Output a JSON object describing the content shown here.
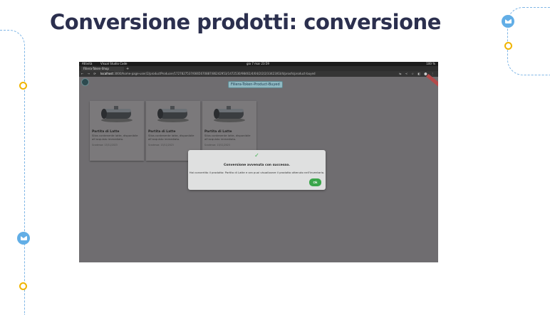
{
  "slide": {
    "title": "Conversione prodotti: conversione"
  },
  "browser": {
    "os_bar": {
      "left": "Attività",
      "app": "Visual Studio Code",
      "clock": "gio 7 mar 23:59",
      "battery": "100 %"
    },
    "tab_label": "Filiera-Token-Shop",
    "tab_plus": "+",
    "url_host": "localhost",
    "url_path": ":3000/home-page-user/2/productProducer/1727827537/6665670887/86242953/1472530/98461/4/04/2/2/2/33423/63/4/proofs/product-buyed",
    "nav_icons": "← → ⟳",
    "url_right_icons": "⇆ ≺ ☆ ◧ ⬤ ⋮"
  },
  "app": {
    "header_title": "Filiera-Token-Product-Buyed",
    "cards": [
      {
        "name": "Partita di Latte",
        "desc": "Silos contenente latte, disponibile all'acquisto immediato.",
        "date": "Scadenza: 13/11/2023"
      },
      {
        "name": "Partita di Latte",
        "desc": "Silos contenente latte, disponibile all'acquisto immediato.",
        "date": "Scadenza: 13/11/2023"
      },
      {
        "name": "Partita di Latte",
        "desc": "Silos contenente latte, disponibile all'acquisto immediato.",
        "date": "Scadenza: 13/11/2023"
      }
    ]
  },
  "dialog": {
    "check": "✓",
    "title": "Conversione avvenuta con successo.",
    "message": "Hai convertito il prodotto: Partita di Latte e ora puoi visualizzare il prodotto ottenuto nell'inventario.",
    "ok_label": "Ok"
  },
  "colors": {
    "title": "#2b2f4e",
    "deco_line": "#7fb6e6",
    "mail_icon": "#62aee6",
    "ring": "#f0b400",
    "overlay": "#6f6d70",
    "ok_button": "#3aa54a"
  },
  "icons": [
    "mail-icon",
    "ring-icon",
    "check-icon",
    "app-logo-icon",
    "silo-icon"
  ]
}
